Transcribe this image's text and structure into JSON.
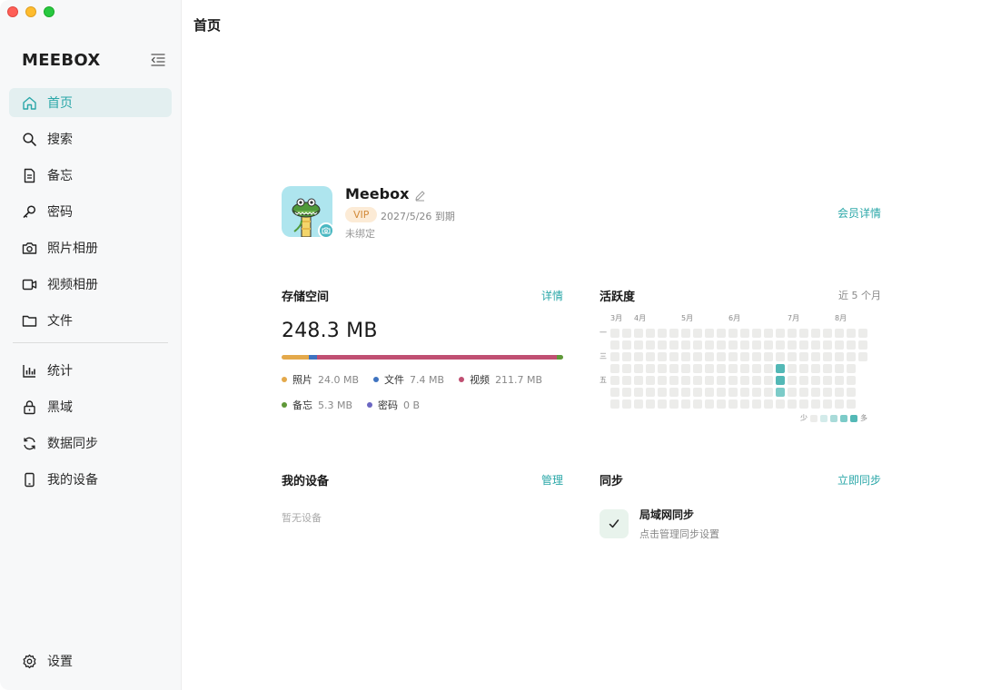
{
  "sidebar": {
    "brand": "MEEBOX",
    "items": [
      {
        "label": "首页",
        "icon": "home-icon",
        "active": true
      },
      {
        "label": "搜索",
        "icon": "search-icon"
      },
      {
        "label": "备忘",
        "icon": "memo-icon"
      },
      {
        "label": "密码",
        "icon": "key-icon"
      },
      {
        "label": "照片相册",
        "icon": "camera-icon"
      },
      {
        "label": "视频相册",
        "icon": "video-icon"
      },
      {
        "label": "文件",
        "icon": "folder-icon"
      }
    ],
    "items2": [
      {
        "label": "统计",
        "icon": "stats-icon"
      },
      {
        "label": "黑域",
        "icon": "lock-icon"
      },
      {
        "label": "数据同步",
        "icon": "sync-icon"
      },
      {
        "label": "我的设备",
        "icon": "phone-icon"
      }
    ],
    "settings": "设置"
  },
  "page_title": "首页",
  "profile": {
    "name": "Meebox",
    "vip": "VIP",
    "expire": "2027/5/26 到期",
    "bind_status": "未绑定",
    "member_link": "会员详情"
  },
  "storage": {
    "title": "存储空间",
    "link": "详情",
    "total": "248.3 MB",
    "segments": [
      {
        "label": "照片",
        "value": "24.0 MB",
        "mb": 24.0,
        "color": "#e4a94b"
      },
      {
        "label": "文件",
        "value": "7.4 MB",
        "mb": 7.4,
        "color": "#3f73c0"
      },
      {
        "label": "视频",
        "value": "211.7 MB",
        "mb": 211.7,
        "color": "#c04f72"
      },
      {
        "label": "备忘",
        "value": "5.3 MB",
        "mb": 5.3,
        "color": "#5f9838"
      },
      {
        "label": "密码",
        "value": "0 B",
        "mb": 0,
        "color": "#6b66c2"
      }
    ]
  },
  "activity": {
    "title": "活跃度",
    "range": "近 5 个月",
    "months": [
      "3月",
      "4月",
      "5月",
      "6月",
      "7月",
      "8月"
    ],
    "days": [
      "一",
      "三",
      "五"
    ],
    "legend_less": "少",
    "legend_more": "多",
    "level_colors": [
      "#ececea",
      "#d3ebea",
      "#a9dbd9",
      "#7ccbc8",
      "#53b8b6"
    ],
    "active_cells": [
      {
        "week": 14,
        "day": 3,
        "level": 4
      },
      {
        "week": 14,
        "day": 4,
        "level": 4
      },
      {
        "week": 14,
        "day": 5,
        "level": 3
      }
    ]
  },
  "devices": {
    "title": "我的设备",
    "link": "管理",
    "empty": "暂无设备"
  },
  "sync": {
    "title": "同步",
    "link": "立即同步",
    "item_name": "局域网同步",
    "item_desc": "点击管理同步设置"
  }
}
